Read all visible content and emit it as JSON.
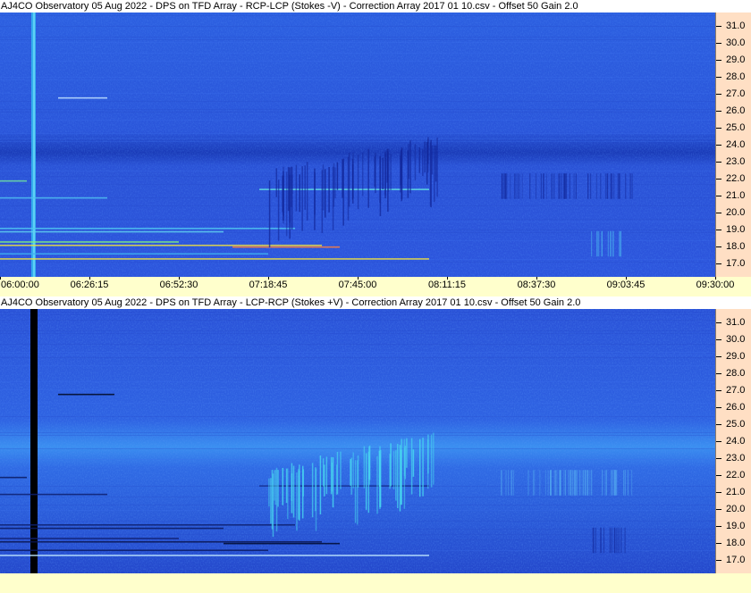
{
  "chart_data": [
    {
      "type": "heatmap",
      "title": "AJ4CO Observatory 05 Aug 2022  -  DPS on TFD Array  -  RCP-LCP (Stokes -V)  -  Correction Array 2017 01 10.csv  -  Offset 50  Gain 2.0",
      "x_ticks": [
        "06:00:00",
        "06:26:15",
        "06:52:30",
        "07:18:45",
        "07:45:00",
        "08:11:15",
        "08:37:30",
        "09:03:45",
        "09:30:00"
      ],
      "y_ticks": [
        "31.0",
        "30.0",
        "29.0",
        "28.0",
        "27.0",
        "26.0",
        "25.0",
        "24.0",
        "23.0",
        "22.0",
        "21.0",
        "20.0",
        "19.0",
        "18.0",
        "17.0"
      ],
      "ylim": [
        16.2,
        31.8
      ],
      "base_color": "#2c55dd",
      "bright_color": "#40e0f0",
      "dark_color": "#12279a"
    },
    {
      "type": "heatmap",
      "title": "AJ4CO Observatory 05 Aug 2022  -  DPS on TFD Array  -  LCP-RCP (Stokes +V)  -  Correction Array 2017 01 10.csv  -  Offset 50  Gain 2.0",
      "x_ticks": [],
      "y_ticks": [
        "31.0",
        "30.0",
        "29.0",
        "28.0",
        "27.0",
        "26.0",
        "25.0",
        "24.0",
        "23.0",
        "22.0",
        "21.0",
        "20.0",
        "19.0",
        "18.0",
        "17.0"
      ],
      "ylim": [
        16.2,
        31.8
      ],
      "base_color": "#2c55dd",
      "bright_color": "#40e0f0",
      "dark_color": "#12279a"
    }
  ]
}
